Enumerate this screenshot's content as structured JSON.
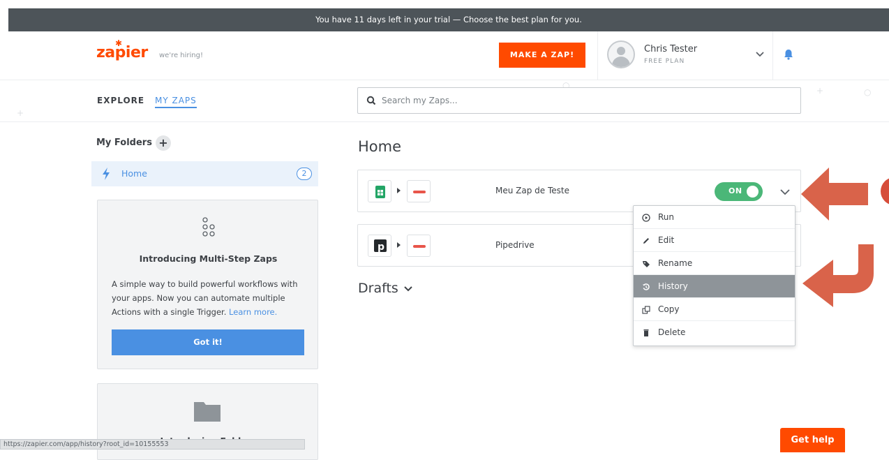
{
  "trial_banner": "You have 11 days left in your trial — Choose the best plan for you.",
  "header": {
    "logo": "zapier",
    "hiring": "we're hiring!",
    "make_zap": "MAKE A ZAP!",
    "user_name": "Chris Tester",
    "user_plan": "FREE PLAN"
  },
  "nav": {
    "explore": "EXPLORE",
    "my_zaps": "MY ZAPS"
  },
  "search": {
    "placeholder": "Search my Zaps..."
  },
  "sidebar": {
    "folders_title": "My Folders",
    "add": "+",
    "home_label": "Home",
    "home_count": "2",
    "intro_card": {
      "title": "Introducing Multi-Step Zaps",
      "text": "A simple way to build powerful workflows with your apps. Now you can automate multiple Actions with a single Trigger.",
      "link": "Learn more.",
      "button": "Got it!"
    },
    "folders_card": {
      "title": "Introducing Folders"
    }
  },
  "main": {
    "title": "Home",
    "zaps": [
      {
        "name": "Meu Zap de Teste",
        "toggle": "ON"
      },
      {
        "name": "Pipedrive"
      }
    ],
    "drafts": "Drafts"
  },
  "menu": {
    "items": [
      "Run",
      "Edit",
      "Rename",
      "History",
      "Copy",
      "Delete"
    ],
    "active": "History"
  },
  "status_url": "https://zapier.com/app/history?root_id=10155553",
  "get_help": "Get help",
  "colors": {
    "brand": "#ff4a00",
    "accent": "#4a90e2",
    "toggle_on": "#4bb778",
    "annotation": "#d9634a"
  }
}
